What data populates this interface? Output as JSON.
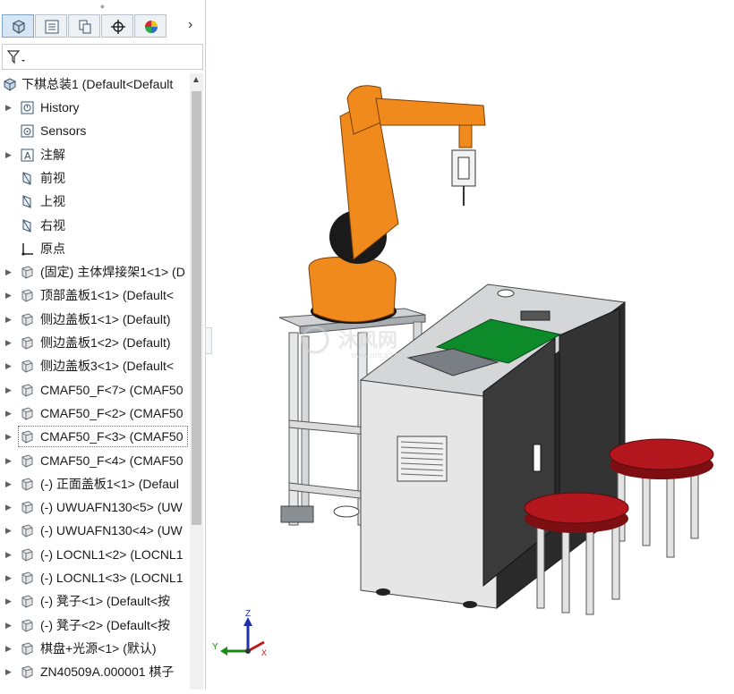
{
  "panel": {
    "tabs": [
      {
        "name": "feature-manager",
        "icon": "part-icon",
        "active": true
      },
      {
        "name": "property-manager",
        "icon": "property-list-icon",
        "active": false
      },
      {
        "name": "configuration-manager",
        "icon": "configuration-icon",
        "active": false
      },
      {
        "name": "dimxpert-manager",
        "icon": "crosshair-icon",
        "active": false
      },
      {
        "name": "display-manager",
        "icon": "color-wheel-icon",
        "active": false
      }
    ],
    "more_glyph": "›",
    "filter_icon": "filter-icon"
  },
  "tree": {
    "root": {
      "label": "下棋总装1 (Default<Default",
      "icon": "assembly-icon"
    },
    "items": [
      {
        "label": "History",
        "icon": "history-icon",
        "expandable": true
      },
      {
        "label": "Sensors",
        "icon": "sensor-icon",
        "expandable": false
      },
      {
        "label": "注解",
        "icon": "annotation-icon",
        "expandable": true
      },
      {
        "label": "前视",
        "icon": "plane-icon",
        "expandable": false
      },
      {
        "label": "上视",
        "icon": "plane-icon",
        "expandable": false
      },
      {
        "label": "右视",
        "icon": "plane-icon",
        "expandable": false
      },
      {
        "label": "原点",
        "icon": "origin-icon",
        "expandable": false
      },
      {
        "label": "(固定) 主体焊接架1<1> (D",
        "icon": "component-icon",
        "expandable": true
      },
      {
        "label": "顶部盖板1<1> (Default<",
        "icon": "component-icon",
        "expandable": true
      },
      {
        "label": "侧边盖板1<1> (Default)",
        "icon": "component-icon",
        "expandable": true
      },
      {
        "label": "侧边盖板1<2> (Default)",
        "icon": "component-icon",
        "expandable": true
      },
      {
        "label": "侧边盖板3<1> (Default<",
        "icon": "component-icon",
        "expandable": true
      },
      {
        "label": "CMAF50_F<7> (CMAF50",
        "icon": "component-icon",
        "expandable": true
      },
      {
        "label": "CMAF50_F<2> (CMAF50",
        "icon": "component-icon",
        "expandable": true
      },
      {
        "label": "CMAF50_F<3> (CMAF50",
        "icon": "component-icon",
        "expandable": true,
        "selected": true
      },
      {
        "label": "CMAF50_F<4> (CMAF50",
        "icon": "component-icon",
        "expandable": true
      },
      {
        "label": "(-) 正面盖板1<1> (Defaul",
        "icon": "component-icon",
        "expandable": true
      },
      {
        "label": "(-) UWUAFN130<5> (UW",
        "icon": "component-icon",
        "expandable": true
      },
      {
        "label": "(-) UWUAFN130<4> (UW",
        "icon": "component-icon",
        "expandable": true
      },
      {
        "label": "(-) LOCNL1<2> (LOCNL1",
        "icon": "component-icon",
        "expandable": true
      },
      {
        "label": "(-) LOCNL1<3> (LOCNL1",
        "icon": "component-icon",
        "expandable": true
      },
      {
        "label": "(-) 凳子<1> (Default<按",
        "icon": "component-icon",
        "expandable": true
      },
      {
        "label": "(-) 凳子<2> (Default<按",
        "icon": "component-icon",
        "expandable": true
      },
      {
        "label": "棋盘+光源<1> (默认)",
        "icon": "component-icon",
        "expandable": true
      },
      {
        "label": "ZN40509A.000001 棋子",
        "icon": "component-icon",
        "expandable": true
      }
    ]
  },
  "viewport": {
    "watermark": "沐风网",
    "watermark_url": "www.mfcad.com",
    "triad": {
      "x": "X",
      "y": "Y",
      "z": "Z"
    },
    "colors": {
      "robot": "#f08a1c",
      "robot_dark": "#1a1a1a",
      "cabinet": "#d8d8d8",
      "board": "#0d8a2a",
      "stool_seat": "#b3161c"
    }
  }
}
